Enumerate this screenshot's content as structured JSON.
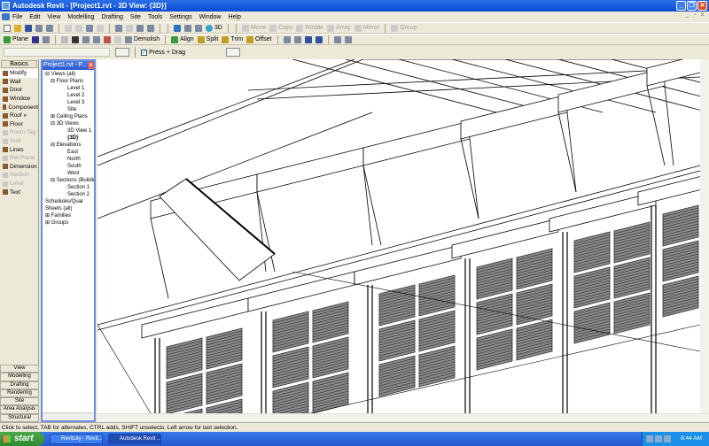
{
  "window": {
    "title": "Autodesk Revit - [Project1.rvt - 3D View: {3D}]",
    "minimize": "_",
    "restore": "❐",
    "close": "✕"
  },
  "menu": [
    "File",
    "Edit",
    "View",
    "Modelling",
    "Drafting",
    "Site",
    "Tools",
    "Settings",
    "Window",
    "Help"
  ],
  "toolbar1": {
    "view_3d": "3D",
    "move": "Move",
    "copy": "Copy",
    "rotate": "Rotate",
    "array": "Array",
    "mirror": "Mirror",
    "group": "Group"
  },
  "toolbar2": {
    "plane": "Plane",
    "demolish": "Demolish",
    "align": "Align",
    "split": "Split",
    "trim": "Trim",
    "offset": "Offset"
  },
  "options": {
    "press_drag": "Press + Drag",
    "press_drag_checked": true
  },
  "designbar": {
    "header": "Basics",
    "items": [
      {
        "label": "Modify",
        "enabled": true,
        "selected": true
      },
      {
        "label": "Wall",
        "enabled": true
      },
      {
        "label": "Door",
        "enabled": true
      },
      {
        "label": "Window",
        "enabled": true
      },
      {
        "label": "Component",
        "enabled": true
      },
      {
        "label": "Roof »",
        "enabled": true
      },
      {
        "label": "Floor",
        "enabled": true
      },
      {
        "label": "Room Tag",
        "enabled": false
      },
      {
        "label": "Grid",
        "enabled": false
      },
      {
        "label": "Lines",
        "enabled": true
      },
      {
        "label": "Ref Plane",
        "enabled": false
      },
      {
        "label": "Dimension",
        "enabled": true
      },
      {
        "label": "Section",
        "enabled": false
      },
      {
        "label": "Level",
        "enabled": false
      },
      {
        "label": "Text",
        "enabled": true
      }
    ],
    "tabs": [
      "View",
      "Modelling",
      "Drafting",
      "Rendering",
      "Site",
      "Area Analysis",
      "Structural"
    ]
  },
  "browser": {
    "title": "Project1.rvt - P...",
    "tree": [
      {
        "label": "Views (all)",
        "level": 0,
        "sign": "⊟"
      },
      {
        "label": "Floor Plans",
        "level": 1,
        "sign": "⊟"
      },
      {
        "label": "Level 1",
        "level": 2
      },
      {
        "label": "Level 2",
        "level": 2
      },
      {
        "label": "Level 3",
        "level": 2
      },
      {
        "label": "Site",
        "level": 2
      },
      {
        "label": "Ceiling Plans",
        "level": 1,
        "sign": "⊞"
      },
      {
        "label": "3D Views",
        "level": 1,
        "sign": "⊟"
      },
      {
        "label": "3D View 1",
        "level": 2
      },
      {
        "label": "{3D}",
        "level": 2,
        "bold": true
      },
      {
        "label": "Elevations",
        "level": 1,
        "sign": "⊟"
      },
      {
        "label": "East",
        "level": 2
      },
      {
        "label": "North",
        "level": 2
      },
      {
        "label": "South",
        "level": 2
      },
      {
        "label": "West",
        "level": 2
      },
      {
        "label": "Sections (Building",
        "level": 1,
        "sign": "⊟"
      },
      {
        "label": "Section 1",
        "level": 2
      },
      {
        "label": "Section 2",
        "level": 2
      },
      {
        "label": "Schedules/Quar",
        "level": 0,
        "sign": " "
      },
      {
        "label": "Sheets (all)",
        "level": 0,
        "sign": " "
      },
      {
        "label": "Families",
        "level": 0,
        "sign": "⊞"
      },
      {
        "label": "Groups",
        "level": 0,
        "sign": "⊞"
      }
    ]
  },
  "status": "Click to select, TAB for alternates, CTRL adds, SHIFT unselects. Left arrow for last selection.",
  "taskbar": {
    "start": "start",
    "tasks": [
      "Revitcity - Revit...",
      "Autodesk Revit ..."
    ],
    "clock": "8:44 AM"
  }
}
